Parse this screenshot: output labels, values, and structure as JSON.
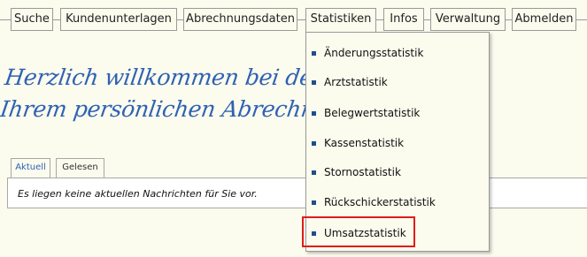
{
  "nav": {
    "items": [
      {
        "label": "Suche"
      },
      {
        "label": "Kundenunterlagen"
      },
      {
        "label": "Abrechnungsdaten"
      },
      {
        "label": "Statistiken"
      },
      {
        "label": "Infos"
      },
      {
        "label": "Verwaltung"
      },
      {
        "label": "Abmelden"
      }
    ]
  },
  "welcome": {
    "line1": "Herzlich willkommen bei der DZH",
    "line2": "Ihrem persönlichen Abrechnungshaus"
  },
  "tabs": [
    {
      "label": "Aktuell"
    },
    {
      "label": "Gelesen"
    }
  ],
  "panel": {
    "message": "Es liegen keine aktuellen Nachrichten für Sie vor."
  },
  "dropdown": {
    "items": [
      {
        "label": "Änderungsstatistik"
      },
      {
        "label": "Arztstatistik"
      },
      {
        "label": "Belegwertstatistik"
      },
      {
        "label": "Kassenstatistik"
      },
      {
        "label": "Stornostatistik"
      },
      {
        "label": "Rückschickerstatistik"
      },
      {
        "label": "Umsatzstatistik"
      }
    ]
  },
  "colors": {
    "background": "#fbfbee",
    "accent": "#2f62b3",
    "bullet": "#1f4e8c",
    "highlight": "#e01c1c"
  }
}
